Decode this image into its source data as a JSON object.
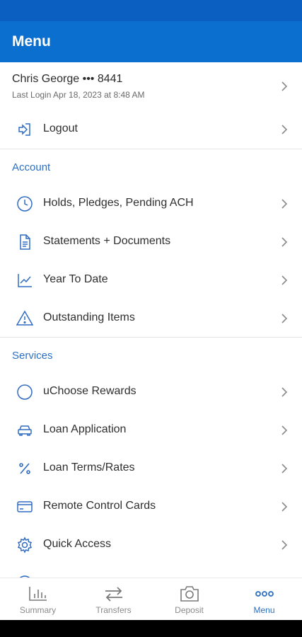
{
  "header": {
    "title": "Menu"
  },
  "profile": {
    "name": "Chris George ••• 8441",
    "last_login": "Last Login Apr 18, 2023 at 8:48 AM"
  },
  "logout": {
    "label": "Logout",
    "icon": "logout-icon"
  },
  "sections": {
    "account": {
      "title": "Account",
      "items": [
        {
          "label": "Holds, Pledges, Pending ACH",
          "icon": "clock-icon"
        },
        {
          "label": "Statements + Documents",
          "icon": "document-icon"
        },
        {
          "label": "Year To Date",
          "icon": "line-chart-icon"
        },
        {
          "label": "Outstanding Items",
          "icon": "warning-icon"
        }
      ]
    },
    "services": {
      "title": "Services",
      "items": [
        {
          "label": "uChoose Rewards",
          "icon": "circle-icon"
        },
        {
          "label": "Loan Application",
          "icon": "car-icon"
        },
        {
          "label": "Loan Terms/Rates",
          "icon": "percent-icon"
        },
        {
          "label": "Remote Control Cards",
          "icon": "card-icon"
        },
        {
          "label": "Quick Access",
          "icon": "gear-icon"
        }
      ]
    }
  },
  "bottom_nav": {
    "items": [
      {
        "label": "Summary",
        "icon": "bar-chart-icon"
      },
      {
        "label": "Transfers",
        "icon": "transfer-arrows-icon"
      },
      {
        "label": "Deposit",
        "icon": "camera-icon"
      },
      {
        "label": "Menu",
        "icon": "more-icon",
        "active": true
      }
    ]
  },
  "colors": {
    "header": "#0b6fd0",
    "status_bar": "#0a5fc0",
    "accent": "#2c6fc4",
    "icon": "#2f6bc0"
  }
}
